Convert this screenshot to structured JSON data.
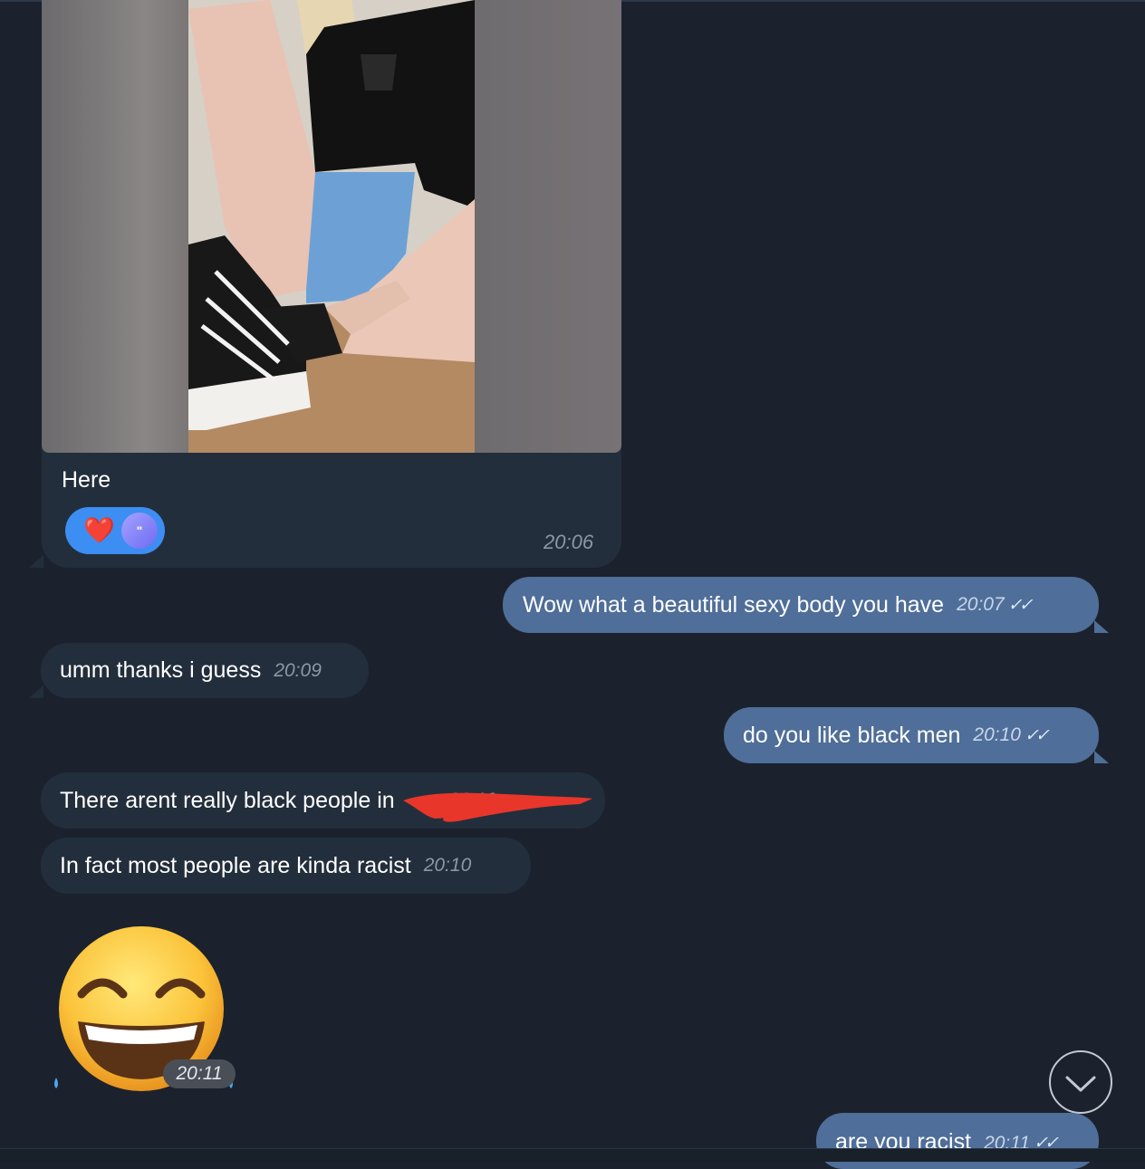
{
  "messages": {
    "m1": {
      "text": "Here",
      "time": "20:06",
      "reaction_emoji": "❤️",
      "reaction_badge": "\""
    },
    "m2": {
      "text": "Wow what a beautiful sexy body you have",
      "time": "20:07",
      "status": "✓✓"
    },
    "m3": {
      "text": "umm thanks i guess",
      "time": "20:09"
    },
    "m4": {
      "text": "do you like black men",
      "time": "20:10",
      "status": "✓✓"
    },
    "m5": {
      "text": "There arent really black people in",
      "time": "20:10"
    },
    "m6": {
      "text": "In fact most people are kinda racist",
      "time": "20:10"
    },
    "m7": {
      "emoji": "grinning-squinting-face-with-sweat-drops",
      "time": "20:11"
    },
    "m8": {
      "text": "are you racist",
      "time": "20:11",
      "status": "✓✓"
    }
  },
  "colors": {
    "background": "#1b222d",
    "incoming_bubble": "#232e3c",
    "outgoing_bubble": "#4f6e99",
    "reaction": "#3c8ef2",
    "redaction": "#e8362b"
  },
  "icons": {
    "scroll_down": "chevron-down-icon"
  }
}
